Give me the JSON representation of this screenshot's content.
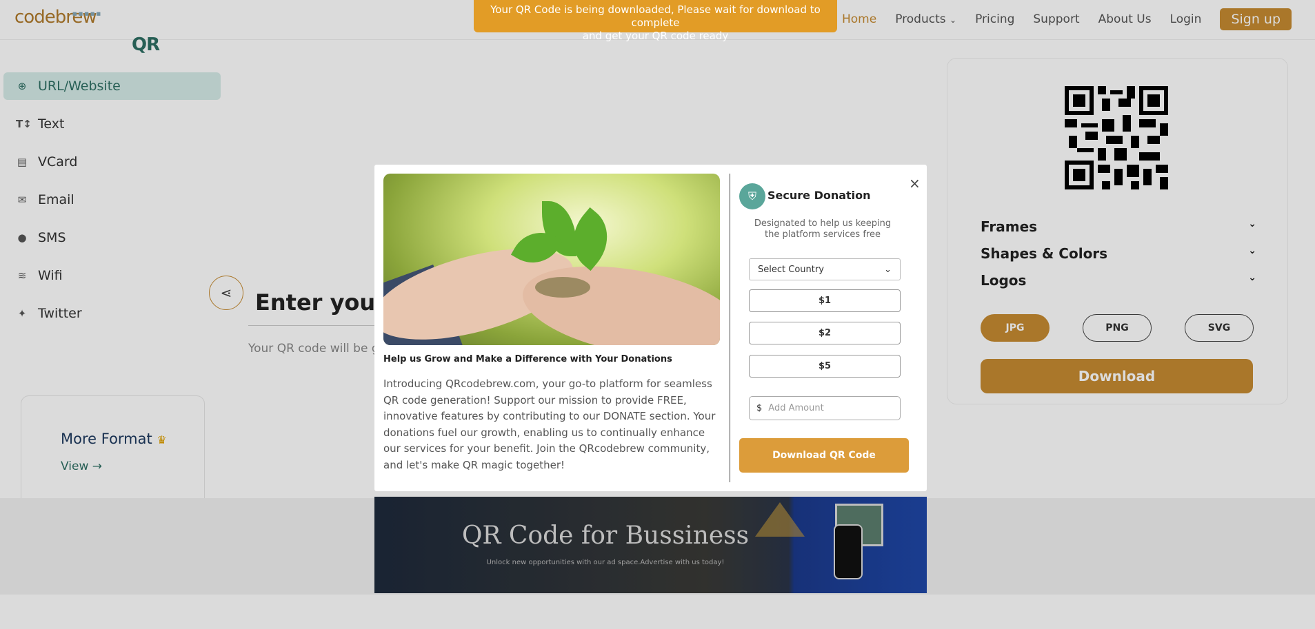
{
  "header": {
    "logo_qr": "QR",
    "logo_rest": "codebrew",
    "nav": [
      "Home",
      "Products",
      "Pricing",
      "Support",
      "About Us",
      "Login"
    ],
    "signup": "Sign up",
    "products_chevron": "chevron-down-icon"
  },
  "toast": {
    "line1": "Your QR Code is being downloaded, Please wait for download to complete",
    "line2": "and get your QR code ready"
  },
  "sidebar": {
    "items": [
      {
        "label": "URL/Website",
        "icon": "globe-icon",
        "active": true
      },
      {
        "label": "Text",
        "icon": "text-icon"
      },
      {
        "label": "VCard",
        "icon": "vcard-icon"
      },
      {
        "label": "Email",
        "icon": "email-icon"
      },
      {
        "label": "SMS",
        "icon": "sms-icon"
      },
      {
        "label": "Wifi",
        "icon": "wifi-icon"
      },
      {
        "label": "Twitter",
        "icon": "twitter-icon"
      }
    ],
    "more_title": "More Format",
    "more_view": "View →"
  },
  "main": {
    "enter_title": "Enter your w",
    "gen_note": "Your QR code will be ge"
  },
  "panel": {
    "accordions": [
      "Frames",
      "Shapes & Colors",
      "Logos"
    ],
    "formats": [
      "JPG",
      "PNG",
      "SVG"
    ],
    "download": "Download"
  },
  "banner": {
    "title": "QR Code for Bussiness",
    "subtitle": "Unlock new opportunities with our ad space.Advertise with us today!"
  },
  "modal": {
    "close": "×",
    "image_caption": "Help us Grow and Make a Difference with Your Donations",
    "body": "Introducing QRcodebrew.com, your go-to platform for seamless QR code generation! Support our mission to provide FREE, innovative features by contributing to our DONATE section. Your donations fuel our growth, enabling us to continually enhance our services for your benefit. Join the QRcodebrew community, and let's make QR magic together!",
    "title": "Secure Donation",
    "subtitle": "Designated to help us keeping the platform services free",
    "country_placeholder": "Select Country",
    "amounts": [
      "$1",
      "$2",
      "$5"
    ],
    "currency": "$",
    "custom_placeholder": "Add Amount",
    "download_button": "Download QR Code"
  },
  "colors": {
    "accent": "#c68b32",
    "brand": "#2e6f63",
    "toast": "#e29c26"
  }
}
